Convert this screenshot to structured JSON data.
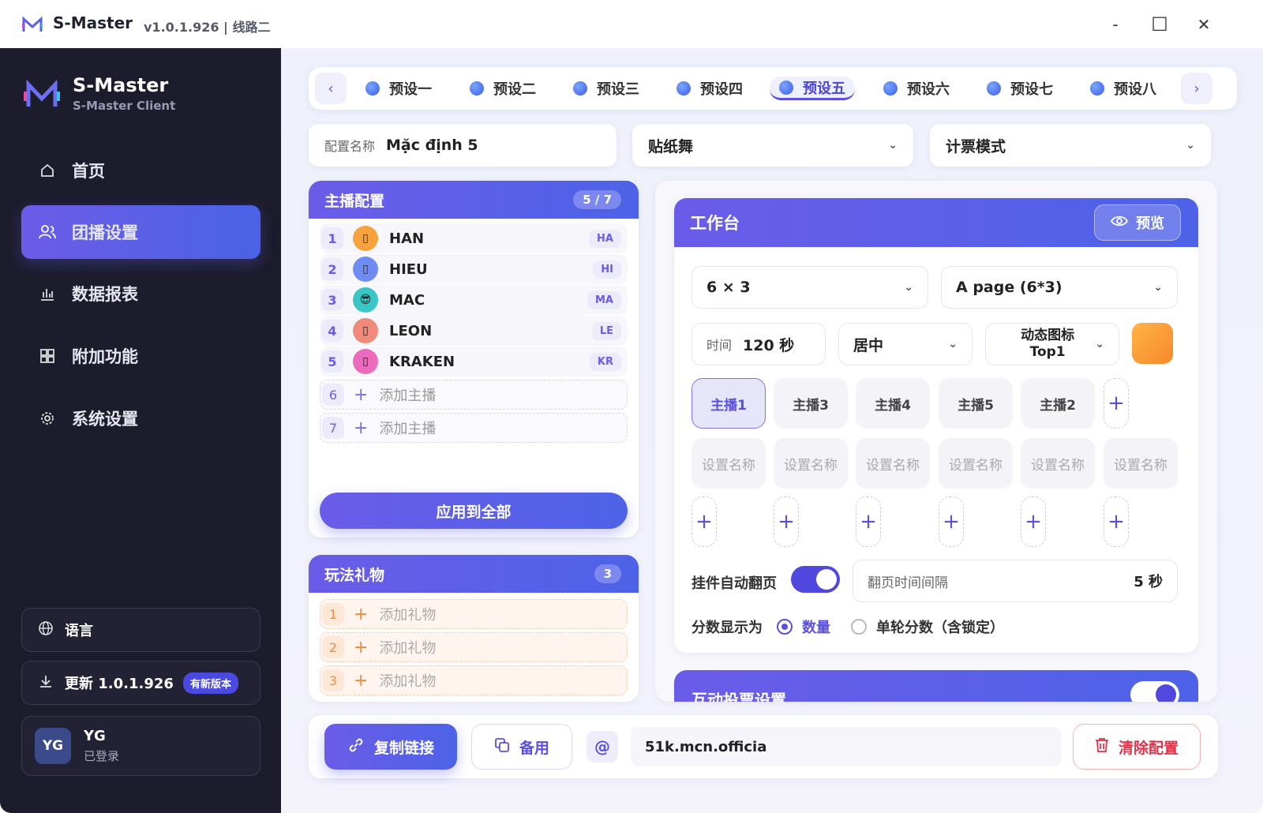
{
  "titlebar": {
    "app_name": "S-Master",
    "version": "v1.0.1.926 | 线路二",
    "minimize": "-",
    "maximize": "☐",
    "close": "✕"
  },
  "sidebar": {
    "brand_name": "S-Master",
    "brand_sub": "S-Master Client",
    "items": [
      {
        "label": "首页",
        "icon": "home-icon"
      },
      {
        "label": "团播设置",
        "icon": "users-icon",
        "active": true
      },
      {
        "label": "数据报表",
        "icon": "bar-chart-icon"
      },
      {
        "label": "附加功能",
        "icon": "grid-icon"
      },
      {
        "label": "系统设置",
        "icon": "gear-icon"
      }
    ],
    "language_label": "语言",
    "update_label": "更新 1.0.1.926",
    "update_badge": "有新版本",
    "user_initials": "YG",
    "user_name": "YG",
    "user_status": "已登录"
  },
  "tabs": {
    "prev": "‹",
    "next": "›",
    "items": [
      "预设一",
      "预设二",
      "预设三",
      "预设四",
      "预设五",
      "预设六",
      "预设七",
      "预设八"
    ],
    "active_index": 4
  },
  "config": {
    "name_label": "配置名称",
    "name_value": "Mặc định 5",
    "mode_value": "贴纸舞",
    "vote_mode_value": "计票模式"
  },
  "anchors": {
    "title": "主播配置",
    "count": "5 / 7",
    "rows": [
      {
        "num": "1",
        "name": "HAN",
        "abbr": "HA",
        "avatar_color": "#f7a23c",
        "emoji": "▯"
      },
      {
        "num": "2",
        "name": "HIEU",
        "abbr": "HI",
        "avatar_color": "#6f8cf5",
        "emoji": "▯"
      },
      {
        "num": "3",
        "name": "MAC",
        "abbr": "MA",
        "avatar_color": "#38c6c6",
        "emoji": "😎"
      },
      {
        "num": "4",
        "name": "LEON",
        "abbr": "LE",
        "avatar_color": "#f08a7a",
        "emoji": "▯"
      },
      {
        "num": "5",
        "name": "KRAKEN",
        "abbr": "KR",
        "avatar_color": "#ec6bbd",
        "emoji": "▯"
      }
    ],
    "add_rows": [
      {
        "num": "6",
        "label": "添加主播"
      },
      {
        "num": "7",
        "label": "添加主播"
      }
    ],
    "apply_all": "应用到全部"
  },
  "gifts": {
    "title": "玩法礼物",
    "count": "3",
    "rows": [
      {
        "num": "1",
        "label": "添加礼物"
      },
      {
        "num": "2",
        "label": "添加礼物"
      },
      {
        "num": "3",
        "label": "添加礼物"
      }
    ]
  },
  "workbench": {
    "title": "工作台",
    "preview": "预览",
    "grid_value": "6 × 3",
    "page_value": "A page (6*3)",
    "time_label": "时间",
    "time_value": "120 秒",
    "align_value": "居中",
    "icon_mode_line1": "动态图标",
    "icon_mode_line2": "Top1",
    "accent_color": "#f7a23c",
    "anchor_chips": [
      "主播1",
      "主播3",
      "主播4",
      "主播5",
      "主播2"
    ],
    "name_chips": [
      "设置名称",
      "设置名称",
      "设置名称",
      "设置名称",
      "设置名称",
      "设置名称"
    ],
    "auto_page_label": "挂件自动翻页",
    "page_interval_label": "翻页时间间隔",
    "page_interval_value": "5 秒",
    "score_label": "分数显示为",
    "score_opt1": "数量",
    "score_opt2": "单轮分数（含锁定）"
  },
  "vote": {
    "title": "互动投票设置"
  },
  "footer": {
    "copy_link": "复制链接",
    "backup": "备用",
    "at": "@",
    "link_value": "51k.mcn.officia",
    "clear": "清除配置"
  }
}
